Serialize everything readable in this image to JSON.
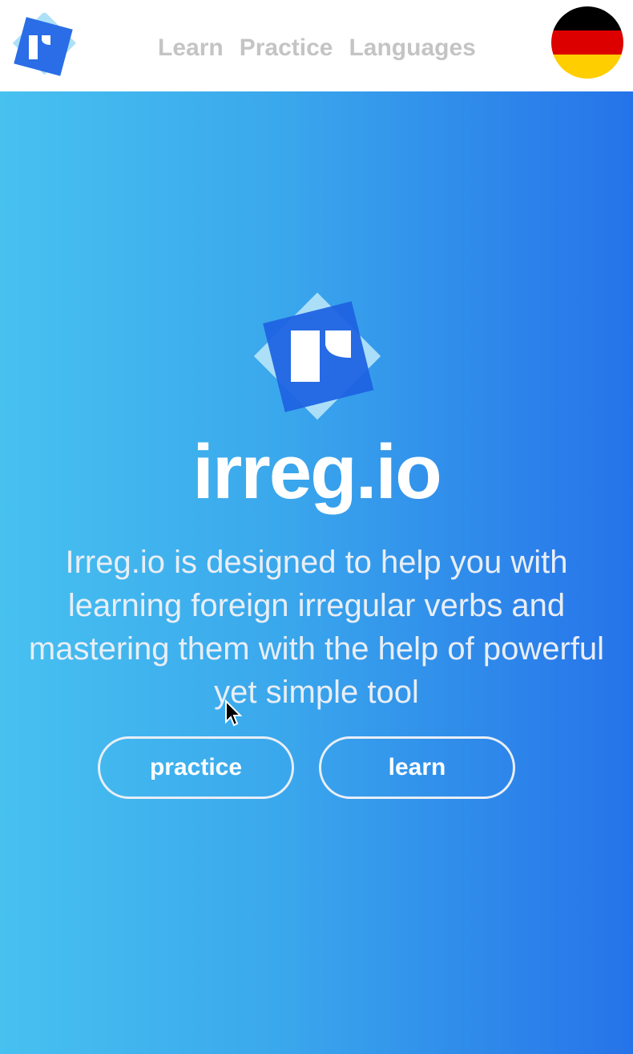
{
  "header": {
    "logo_icon": "irreg-logo-icon",
    "nav": [
      {
        "label": "Learn"
      },
      {
        "label": "Practice"
      },
      {
        "label": "Languages"
      }
    ],
    "language_flag": "germany-flag-icon",
    "flag_colors": [
      "#000000",
      "#dd0000",
      "#ffce00"
    ]
  },
  "hero": {
    "logo_icon": "irreg-logo-icon",
    "brand": "irreg.io",
    "tagline": "Irreg.io is designed to help you with learning foreign irregular verbs and mastering them with the help of powerful yet simple tool",
    "buttons": {
      "practice": "practice",
      "learn": "learn"
    },
    "gradient": [
      "#47c1f0",
      "#2673e9"
    ]
  },
  "colors": {
    "logo_blue": "#2a6de6",
    "logo_light": "#9fdcf6",
    "nav_text": "#c4c4c4"
  }
}
